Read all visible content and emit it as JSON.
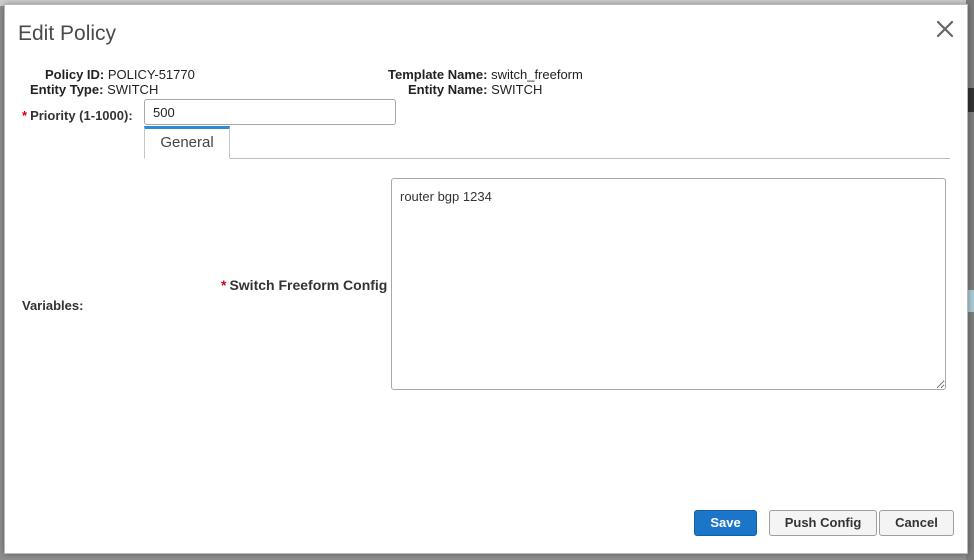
{
  "dialog": {
    "title": "Edit Policy"
  },
  "meta": {
    "policy_id_label": "Policy ID:",
    "policy_id_value": "POLICY-51770",
    "entity_type_label": "Entity Type:",
    "entity_type_value": "SWITCH",
    "template_name_label": "Template Name:",
    "template_name_value": "switch_freeform",
    "entity_name_label": "Entity Name:",
    "entity_name_value": "SWITCH"
  },
  "priority": {
    "required_marker": "*",
    "label": "Priority (1-1000):",
    "value": "500"
  },
  "tabs": [
    {
      "label": "General",
      "active": true
    }
  ],
  "variables": {
    "label": "Variables:",
    "freeform_required_marker": "*",
    "freeform_label": "Switch Freeform Config",
    "freeform_value": "router bgp 1234"
  },
  "buttons": {
    "save": "Save",
    "push_config": "Push Config",
    "cancel": "Cancel"
  },
  "colors": {
    "primary": "#1b76c9",
    "tab_accent": "#2d8cd6",
    "required": "#d0021b"
  },
  "icons": {
    "close": "close-icon",
    "resize": "resize-grip-icon"
  }
}
